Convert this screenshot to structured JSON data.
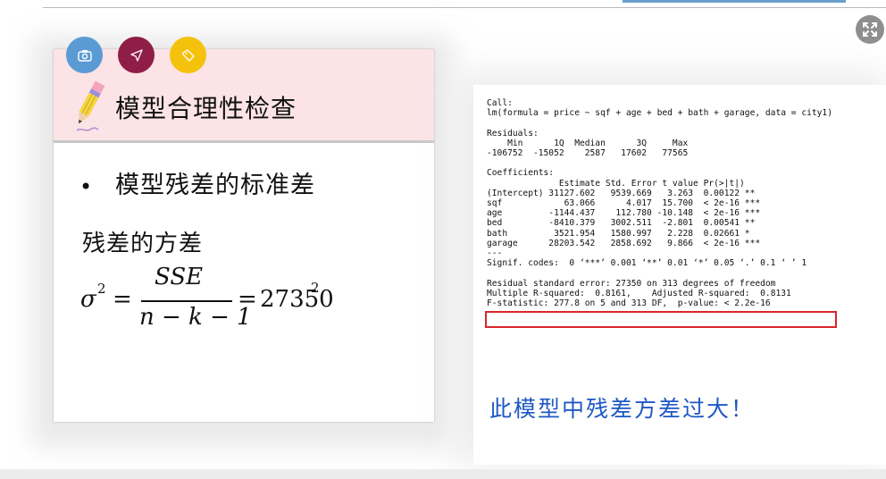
{
  "slide": {
    "title": "模型合理性检查",
    "bullet": "模型残差的标准差",
    "variance_label": "残差的方差",
    "formula": {
      "lhs": "σ",
      "lhs_power": "2",
      "equals": "=",
      "numerator": "SSE",
      "denominator": "n − k − 1",
      "value": "27350",
      "value_power": "2"
    }
  },
  "buttons": {
    "camera": "camera-icon",
    "send": "send-icon",
    "tag": "tag-icon"
  },
  "colors": {
    "camera_button": "#5b9bd3",
    "send_button": "#8f1e47",
    "tag_button": "#f4c20d",
    "header_bg": "#fbe3e6",
    "highlight_box": "#d9262e",
    "conclusion_text": "#1f58c4"
  },
  "r_output": {
    "text": "Call:\nlm(formula = price ~ sqf + age + bed + bath + garage, data = city1)\n\nResiduals:\n    Min      1Q  Median      3Q     Max\n-106752  -15052    2587   17602   77565\n\nCoefficients:\n              Estimate Std. Error t value Pr(>|t|)\n(Intercept) 31127.602   9539.669   3.263  0.00122 **\nsqf            63.066      4.017  15.700  < 2e-16 ***\nage         -1144.437    112.780 -10.148  < 2e-16 ***\nbed         -8410.379   3002.511  -2.801  0.00541 **\nbath         3521.954   1580.997   2.228  0.02661 *\ngarage      28203.542   2858.692   9.866  < 2e-16 ***\n---\nSignif. codes:  0 ‘***’ 0.001 ‘**’ 0.01 ‘*’ 0.05 ‘.’ 0.1 ‘ ’ 1\n\nResidual standard error: 27350 on 313 degrees of freedom\nMultiple R-squared:  0.8161,\tAdjusted R-squared:  0.8131\nF-statistic: 277.8 on 5 and 313 DF,  p-value: < 2.2e-16"
  },
  "conclusion": "此模型中残差方差过大！",
  "controls": {
    "expand": "expand-icon"
  }
}
